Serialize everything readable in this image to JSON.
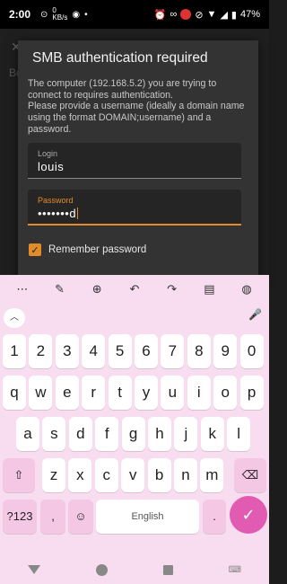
{
  "status_bar": {
    "time": "2:00",
    "left_icons": [
      "nfc-icon",
      "kb-speed-icon",
      "screenshot-icon",
      "dot-icon"
    ],
    "network_speed": "0\nKB/s",
    "battery": "47%",
    "right_icons": [
      "alarm-icon",
      "link-icon",
      "recording-icon",
      "mute-icon",
      "wifi-icon",
      "signal-icon",
      "battery-icon"
    ]
  },
  "background_app": {
    "close_glyph": "✕",
    "partial_text": "Bc"
  },
  "dialog": {
    "title": "SMB authentication required",
    "message": "The computer (192.168.5.2) you are trying to connect to requires authentication.\nPlease provide a username (ideally a domain name using the format DOMAIN;username) and a password.",
    "login": {
      "label": "Login",
      "value": "louis"
    },
    "password": {
      "label": "Password",
      "value": "•••••••d"
    },
    "remember": {
      "label": "Remember password",
      "checked": true
    }
  },
  "keyboard": {
    "toolbar": [
      "more-icon",
      "edit-icon",
      "globe-icon",
      "undo-icon",
      "redo-icon",
      "clipboard-icon",
      "palette-icon"
    ],
    "row_numbers": [
      "1",
      "2",
      "3",
      "4",
      "5",
      "6",
      "7",
      "8",
      "9",
      "0"
    ],
    "row1": [
      "q",
      "w",
      "e",
      "r",
      "t",
      "y",
      "u",
      "i",
      "o",
      "p"
    ],
    "row2": [
      "a",
      "s",
      "d",
      "f",
      "g",
      "h",
      "j",
      "k",
      "l"
    ],
    "row3": [
      "z",
      "x",
      "c",
      "v",
      "b",
      "n",
      "m"
    ],
    "bottom": {
      "symbols": "?123",
      "comma": ",",
      "space": "English",
      "period": "."
    },
    "accent_color": "#e25bb2"
  },
  "nav_bar": [
    "back-icon",
    "home-icon",
    "recents-icon",
    "keyboard-switch-icon"
  ]
}
